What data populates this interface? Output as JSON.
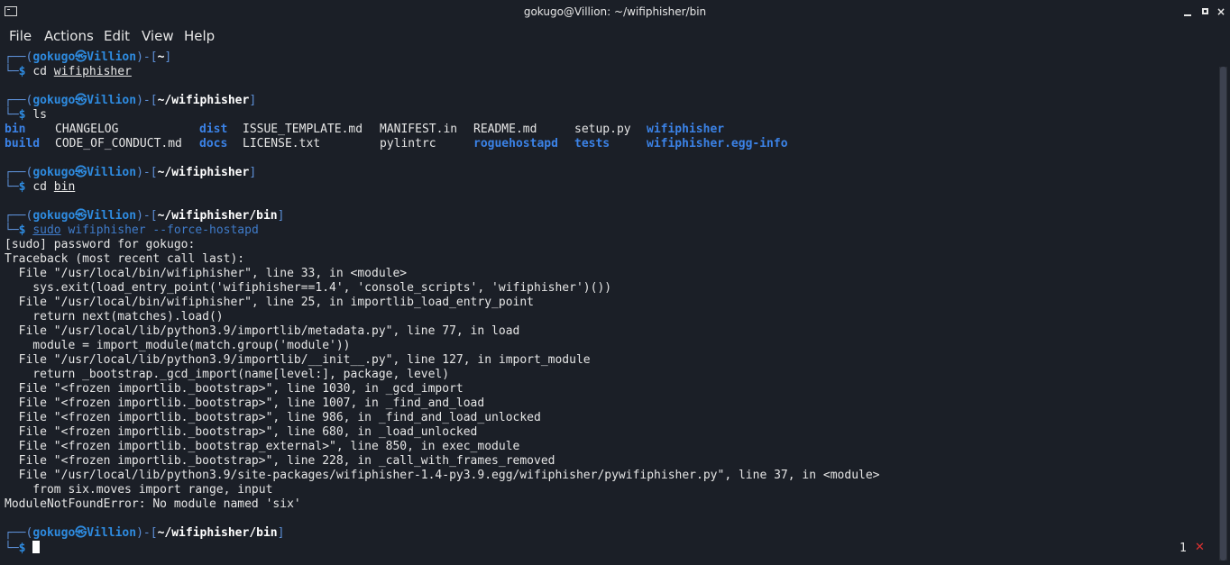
{
  "window": {
    "title": "gokugo@Villion: ~/wifiphisher/bin",
    "close_glyph": "×"
  },
  "menu": [
    "File",
    "Actions",
    "Edit",
    "View",
    "Help"
  ],
  "prompt": {
    "frame_top_open": "┌──(",
    "frame_top_close": ")-[",
    "frame_end": "]",
    "frame_bottom": "└─",
    "at": "㉿",
    "dollar": "$",
    "user": "gokugo",
    "host": "Villion"
  },
  "blocks": [
    {
      "path": "~",
      "cmd_name": "cd",
      "cmd_arg": "wifiphisher"
    },
    {
      "path": "~/wifiphisher",
      "cmd_name": "ls"
    },
    {
      "path": "~/wifiphisher",
      "cmd_name": "cd",
      "cmd_arg": "bin"
    },
    {
      "path": "~/wifiphisher/bin",
      "cmd_name": "sudo",
      "cmd_arg": "wifiphisher",
      "cmd_opt": "--force-hostapd"
    },
    {
      "path": "~/wifiphisher/bin"
    }
  ],
  "ls_output": {
    "row1": [
      "bin",
      "CHANGELOG",
      "dist",
      "ISSUE_TEMPLATE.md",
      "MANIFEST.in",
      "README.md",
      "setup.py",
      "wifiphisher"
    ],
    "row2": [
      "build",
      "CODE_OF_CONDUCT.md",
      "docs",
      "LICENSE.txt",
      "pylintrc",
      "roguehostapd",
      "tests",
      "wifiphisher.egg-info"
    ]
  },
  "output_lines": [
    "[sudo] password for gokugo:",
    "Traceback (most recent call last):",
    "  File \"/usr/local/bin/wifiphisher\", line 33, in <module>",
    "    sys.exit(load_entry_point('wifiphisher==1.4', 'console_scripts', 'wifiphisher')())",
    "  File \"/usr/local/bin/wifiphisher\", line 25, in importlib_load_entry_point",
    "    return next(matches).load()",
    "  File \"/usr/local/lib/python3.9/importlib/metadata.py\", line 77, in load",
    "    module = import_module(match.group('module'))",
    "  File \"/usr/local/lib/python3.9/importlib/__init__.py\", line 127, in import_module",
    "    return _bootstrap._gcd_import(name[level:], package, level)",
    "  File \"<frozen importlib._bootstrap>\", line 1030, in _gcd_import",
    "  File \"<frozen importlib._bootstrap>\", line 1007, in _find_and_load",
    "  File \"<frozen importlib._bootstrap>\", line 986, in _find_and_load_unlocked",
    "  File \"<frozen importlib._bootstrap>\", line 680, in _load_unlocked",
    "  File \"<frozen importlib._bootstrap_external>\", line 850, in exec_module",
    "  File \"<frozen importlib._bootstrap>\", line 228, in _call_with_frames_removed",
    "  File \"/usr/local/lib/python3.9/site-packages/wifiphisher-1.4-py3.9.egg/wifiphisher/pywifiphisher.py\", line 37, in <module>",
    "    from six.moves import range, input",
    "ModuleNotFoundError: No module named 'six'"
  ],
  "status": {
    "count": "1"
  },
  "colors": {
    "background": "#1b1f27",
    "prompt_user": "#2e8be0",
    "directory": "#3b82e6",
    "error_x": "#e03131"
  }
}
